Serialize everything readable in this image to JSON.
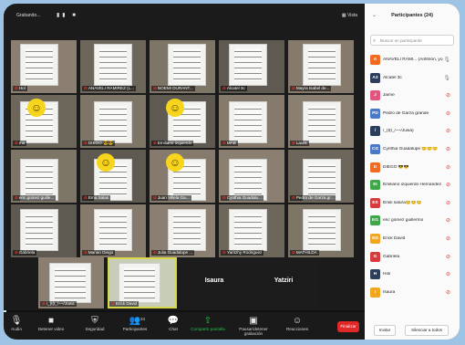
{
  "app": {
    "recording_label": "Grabando...",
    "view_label": "Vista"
  },
  "gallery": {
    "row1": [
      {
        "label": "Hol",
        "smile": false
      },
      {
        "label": "ANAVELI RAMIREZ (L...",
        "smile": false
      },
      {
        "label": "NOEMI DURANT...",
        "smile": false
      },
      {
        "label": "Alcatel 3c",
        "smile": false
      },
      {
        "label": "Mayra Isabel de...",
        "smile": false
      }
    ],
    "row2": [
      {
        "label": "ma",
        "smile": true
      },
      {
        "label": "DIEGO 😎😎",
        "smile": false
      },
      {
        "label": "Emiliano izquierdo",
        "smile": true
      },
      {
        "label": "MAB",
        "smile": false
      },
      {
        "label": "Laura",
        "smile": false
      }
    ],
    "row3": [
      {
        "label": "eric gomez guille...",
        "smile": false
      },
      {
        "label": "Ema Salas",
        "smile": true
      },
      {
        "label": "Juan Villela Ga...",
        "smile": true
      },
      {
        "label": "Cynthia Guadalu...",
        "smile": false
      },
      {
        "label": "Pedro de Garza gr...",
        "smile": false
      }
    ],
    "row4": [
      {
        "label": "Gabriela",
        "smile": false
      },
      {
        "label": "Marian Diego",
        "smile": false
      },
      {
        "label": "Julia Guadalupe ...",
        "smile": false
      },
      {
        "label": "Yaritzhy Rodriguez",
        "smile": false
      },
      {
        "label": "MATHILDA",
        "smile": false
      }
    ],
    "row5": [
      {
        "label": "/_(t(t_/~~/Juwa",
        "smile": false
      },
      {
        "label": "Erick David",
        "smile": false
      }
    ],
    "blank_tiles": [
      "Isaura",
      "Yatziri"
    ]
  },
  "toolbar": {
    "items": [
      {
        "label": "Audio",
        "icon": "mic-icon"
      },
      {
        "label": "Detener video",
        "icon": "video-icon"
      },
      {
        "label": "Seguridad",
        "icon": "shield-icon"
      },
      {
        "label": "Participantes",
        "icon": "people-icon",
        "count": "24"
      },
      {
        "label": "Chat",
        "icon": "chat-icon"
      },
      {
        "label": "Compartir pantalla",
        "icon": "share-screen-icon"
      },
      {
        "label": "Pausar/detener grabación",
        "icon": "record-icon"
      },
      {
        "label": "Reacciones",
        "icon": "reactions-icon"
      }
    ],
    "end_label": "Finalizar"
  },
  "panel": {
    "title": "Participantes (24)",
    "search_placeholder": "Buscar un participante",
    "participants": [
      {
        "initials": "A",
        "name": "ANAVELI RAMI... (Anfitrión, yo)",
        "color": "#f26b21",
        "muted": false
      },
      {
        "initials": "A3",
        "name": "Alcatel 3c",
        "color": "#2b3f5c",
        "muted": false
      },
      {
        "initials": "J",
        "name": "Jaime",
        "color": "#e0557e",
        "muted": true
      },
      {
        "initials": "PD",
        "name": "Pedro de Garza grande",
        "color": "#4a78c8",
        "muted": true
      },
      {
        "initials": "/",
        "name": "/_(t(t_/~~/Juwa)",
        "color": "#2b3f5c",
        "muted": true
      },
      {
        "initials": "CG",
        "name": "Cynthia Guadalupe 😊😊😊",
        "color": "#4a78c8",
        "muted": true
      },
      {
        "initials": "D",
        "name": "DIEGO 😎😎",
        "color": "#f26b21",
        "muted": true
      },
      {
        "initials": "EI",
        "name": "Emiliano izquierdo Hernandez",
        "color": "#3ea849",
        "muted": true
      },
      {
        "initials": "ES",
        "name": "Emili salura😊😊😊",
        "color": "#d63c3c",
        "muted": true
      },
      {
        "initials": "EG",
        "name": "eric gomez guillermo",
        "color": "#3ea849",
        "muted": true
      },
      {
        "initials": "ED",
        "name": "Erick David",
        "color": "#f2a51e",
        "muted": true
      },
      {
        "initials": "G",
        "name": "Gabriela",
        "color": "#d63c3c",
        "muted": true
      },
      {
        "initials": "H",
        "name": "Holi",
        "color": "#2b3f5c",
        "muted": true
      },
      {
        "initials": "I",
        "name": "Isaura",
        "color": "#f2a51e",
        "muted": true
      }
    ],
    "invite_label": "Invitar",
    "mute_all_label": "Silenciar a todos"
  }
}
